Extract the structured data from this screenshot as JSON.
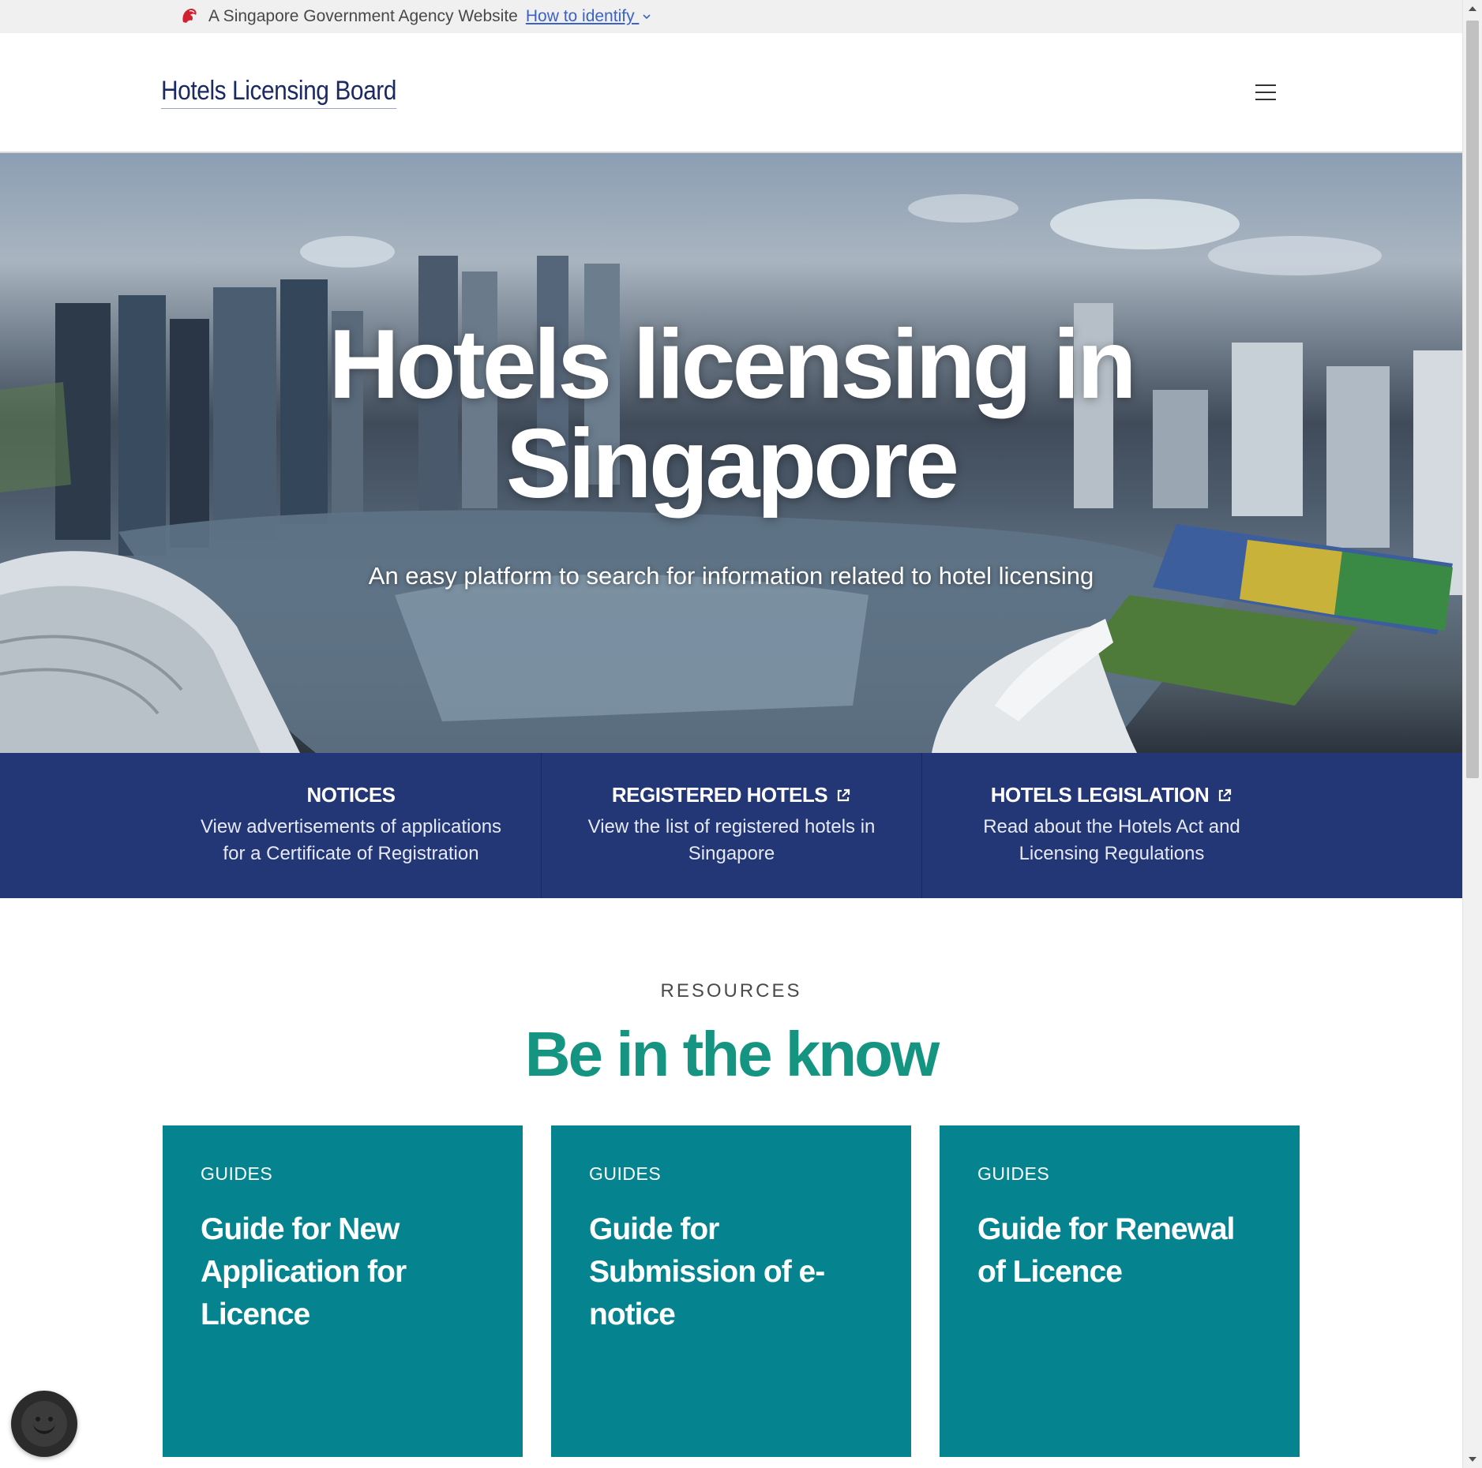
{
  "masthead": {
    "text": "A Singapore Government Agency Website",
    "link": "How to identify"
  },
  "header": {
    "brand": "Hotels Licensing Board"
  },
  "hero": {
    "title_line1": "Hotels licensing in",
    "title_line2": "Singapore",
    "subtitle": "An easy platform to search for information related to hotel licensing"
  },
  "quick_links": [
    {
      "title": "NOTICES",
      "description": "View advertisements of applications for a Certificate of Registration",
      "external": false
    },
    {
      "title": "REGISTERED HOTELS",
      "description": "View the list of registered hotels in Singapore",
      "external": true
    },
    {
      "title": "HOTELS LEGISLATION",
      "description": "Read about the Hotels Act and Licensing Regulations",
      "external": true
    }
  ],
  "resources": {
    "eyebrow": "RESOURCES",
    "heading": "Be in the know",
    "cards": [
      {
        "tag": "GUIDES",
        "title": "Guide for New Application for Licence"
      },
      {
        "tag": "GUIDES",
        "title": "Guide for Submission of e-notice"
      },
      {
        "tag": "GUIDES",
        "title": "Guide for Renewal of Licence"
      }
    ]
  },
  "colors": {
    "masthead_bg": "#f0f0f0",
    "brand_navy": "#1c2a63",
    "band_navy": "#233675",
    "heading_teal": "#149481",
    "card_teal": "#05838f",
    "link_blue": "#3b62c4"
  },
  "icons": [
    "lion-head-icon",
    "chevron-down-icon",
    "hamburger-menu-icon",
    "external-link-icon",
    "chat-bot-icon"
  ]
}
